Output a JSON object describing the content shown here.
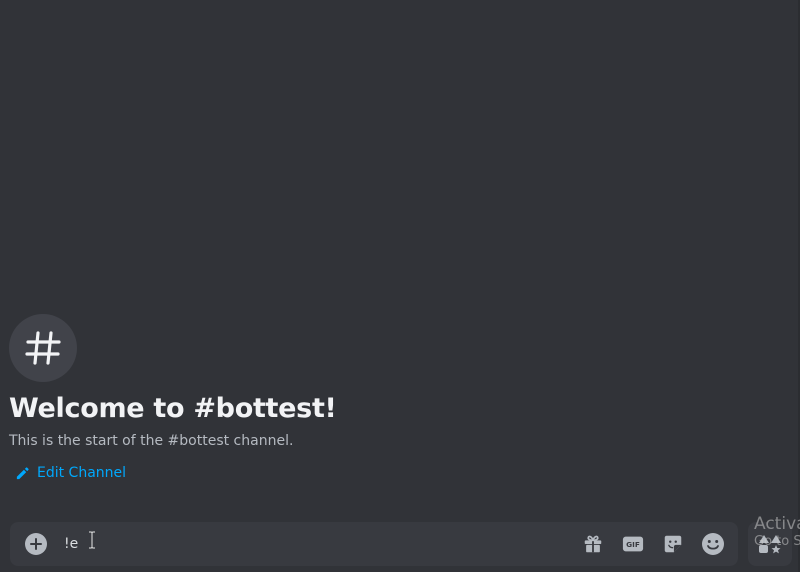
{
  "channel": {
    "hash_symbol": "#",
    "welcome_title": "Welcome to #bottest!",
    "welcome_subtitle": "This is the start of the #bottest channel.",
    "edit_channel_label": "Edit Channel"
  },
  "composer": {
    "input_value": "!e",
    "attach_icon": "plus-circle-icon",
    "tools": [
      {
        "name": "gift-icon"
      },
      {
        "name": "gif-icon",
        "label": "GIF"
      },
      {
        "name": "sticker-icon"
      },
      {
        "name": "emoji-icon"
      }
    ],
    "apps_icon": "app-launcher-icon"
  },
  "watermark": {
    "line1": "Activa",
    "line2": "Go to S"
  },
  "colors": {
    "background": "#313338",
    "composer_bg": "#383a40",
    "link": "#00a8fc",
    "icon": "#b5bac1",
    "title": "#f2f3f5"
  }
}
